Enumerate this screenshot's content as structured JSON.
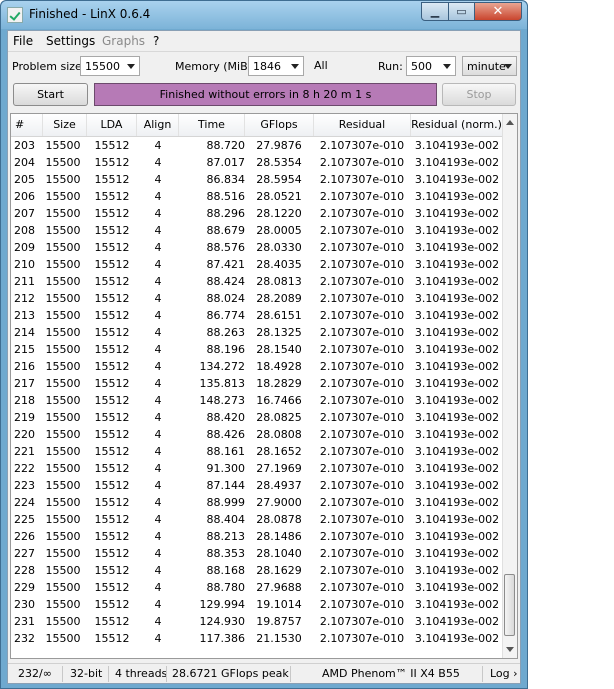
{
  "window": {
    "title": "Finished - LinX 0.6.4"
  },
  "menu": {
    "file": "File",
    "settings": "Settings",
    "graphs": "Graphs",
    "help": "?"
  },
  "controls": {
    "problem_size_label": "Problem size:",
    "problem_size_value": "15500",
    "memory_label": "Memory (MiB):",
    "memory_value": "1846",
    "all_label": "All",
    "run_label": "Run:",
    "run_value": "500",
    "run_unit": "minute",
    "start": "Start",
    "stop": "Stop",
    "status": "Finished without errors in 8 h 20 m 1 s"
  },
  "table": {
    "columns": [
      "#",
      "Size",
      "LDA",
      "Align",
      "Time",
      "GFlops",
      "Residual",
      "Residual (norm.)"
    ],
    "rows": [
      [
        "203",
        "15500",
        "15512",
        "4",
        "88.720",
        "27.9876",
        "2.107307e-010",
        "3.104193e-002"
      ],
      [
        "204",
        "15500",
        "15512",
        "4",
        "87.017",
        "28.5354",
        "2.107307e-010",
        "3.104193e-002"
      ],
      [
        "205",
        "15500",
        "15512",
        "4",
        "86.834",
        "28.5954",
        "2.107307e-010",
        "3.104193e-002"
      ],
      [
        "206",
        "15500",
        "15512",
        "4",
        "88.516",
        "28.0521",
        "2.107307e-010",
        "3.104193e-002"
      ],
      [
        "207",
        "15500",
        "15512",
        "4",
        "88.296",
        "28.1220",
        "2.107307e-010",
        "3.104193e-002"
      ],
      [
        "208",
        "15500",
        "15512",
        "4",
        "88.679",
        "28.0005",
        "2.107307e-010",
        "3.104193e-002"
      ],
      [
        "209",
        "15500",
        "15512",
        "4",
        "88.576",
        "28.0330",
        "2.107307e-010",
        "3.104193e-002"
      ],
      [
        "210",
        "15500",
        "15512",
        "4",
        "87.421",
        "28.4035",
        "2.107307e-010",
        "3.104193e-002"
      ],
      [
        "211",
        "15500",
        "15512",
        "4",
        "88.424",
        "28.0813",
        "2.107307e-010",
        "3.104193e-002"
      ],
      [
        "212",
        "15500",
        "15512",
        "4",
        "88.024",
        "28.2089",
        "2.107307e-010",
        "3.104193e-002"
      ],
      [
        "213",
        "15500",
        "15512",
        "4",
        "86.774",
        "28.6151",
        "2.107307e-010",
        "3.104193e-002"
      ],
      [
        "214",
        "15500",
        "15512",
        "4",
        "88.263",
        "28.1325",
        "2.107307e-010",
        "3.104193e-002"
      ],
      [
        "215",
        "15500",
        "15512",
        "4",
        "88.196",
        "28.1540",
        "2.107307e-010",
        "3.104193e-002"
      ],
      [
        "216",
        "15500",
        "15512",
        "4",
        "134.272",
        "18.4928",
        "2.107307e-010",
        "3.104193e-002"
      ],
      [
        "217",
        "15500",
        "15512",
        "4",
        "135.813",
        "18.2829",
        "2.107307e-010",
        "3.104193e-002"
      ],
      [
        "218",
        "15500",
        "15512",
        "4",
        "148.273",
        "16.7466",
        "2.107307e-010",
        "3.104193e-002"
      ],
      [
        "219",
        "15500",
        "15512",
        "4",
        "88.420",
        "28.0825",
        "2.107307e-010",
        "3.104193e-002"
      ],
      [
        "220",
        "15500",
        "15512",
        "4",
        "88.426",
        "28.0808",
        "2.107307e-010",
        "3.104193e-002"
      ],
      [
        "221",
        "15500",
        "15512",
        "4",
        "88.161",
        "28.1652",
        "2.107307e-010",
        "3.104193e-002"
      ],
      [
        "222",
        "15500",
        "15512",
        "4",
        "91.300",
        "27.1969",
        "2.107307e-010",
        "3.104193e-002"
      ],
      [
        "223",
        "15500",
        "15512",
        "4",
        "87.144",
        "28.4937",
        "2.107307e-010",
        "3.104193e-002"
      ],
      [
        "224",
        "15500",
        "15512",
        "4",
        "88.999",
        "27.9000",
        "2.107307e-010",
        "3.104193e-002"
      ],
      [
        "225",
        "15500",
        "15512",
        "4",
        "88.404",
        "28.0878",
        "2.107307e-010",
        "3.104193e-002"
      ],
      [
        "226",
        "15500",
        "15512",
        "4",
        "88.213",
        "28.1486",
        "2.107307e-010",
        "3.104193e-002"
      ],
      [
        "227",
        "15500",
        "15512",
        "4",
        "88.353",
        "28.1040",
        "2.107307e-010",
        "3.104193e-002"
      ],
      [
        "228",
        "15500",
        "15512",
        "4",
        "88.168",
        "28.1629",
        "2.107307e-010",
        "3.104193e-002"
      ],
      [
        "229",
        "15500",
        "15512",
        "4",
        "88.780",
        "27.9688",
        "2.107307e-010",
        "3.104193e-002"
      ],
      [
        "230",
        "15500",
        "15512",
        "4",
        "129.994",
        "19.1014",
        "2.107307e-010",
        "3.104193e-002"
      ],
      [
        "231",
        "15500",
        "15512",
        "4",
        "124.930",
        "19.8757",
        "2.107307e-010",
        "3.104193e-002"
      ],
      [
        "232",
        "15500",
        "15512",
        "4",
        "117.386",
        "21.1530",
        "2.107307e-010",
        "3.104193e-002"
      ]
    ]
  },
  "statusbar": {
    "progress": "232/∞",
    "bits": "32-bit",
    "threads": "4 threads",
    "peak": "28.6721 GFlops peak",
    "cpu": "AMD Phenom™ II X4 B55",
    "log": "Log ›"
  },
  "icons": {
    "app": "checkmark-app-icon",
    "minimize": "minimize-icon",
    "maximize": "maximize-icon",
    "close": "close-icon",
    "dropdown": "chevron-down-icon"
  },
  "colors": {
    "status_bar": "#b67ab6",
    "title_bar": "#7cb3d8",
    "close_button": "#c9452e"
  }
}
